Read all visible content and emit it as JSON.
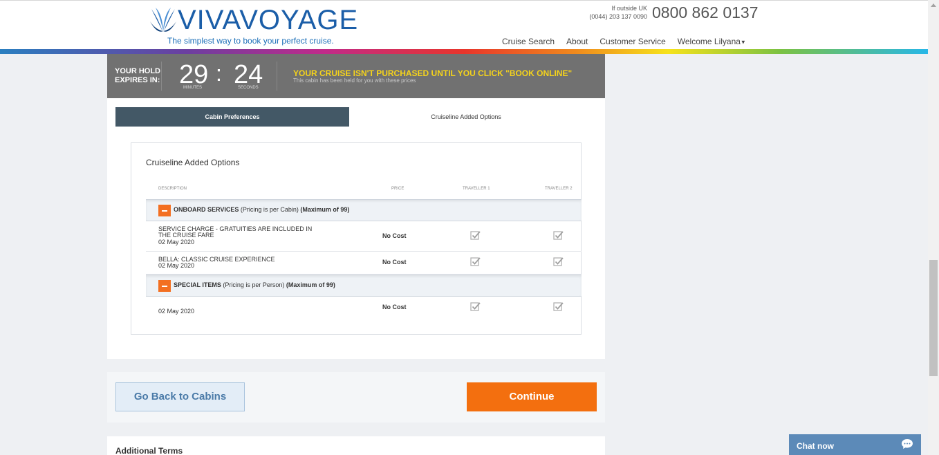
{
  "header": {
    "brand": "VIVAVOYAGE",
    "tagline": "The simplest way to book your perfect cruise.",
    "phone_note_line1": "If outside UK",
    "phone_note_line2": "(0044) 203 137 0090",
    "phone": "0800 862 0137",
    "nav": [
      "Cruise Search",
      "About",
      "Customer Service",
      "Welcome Lilyana"
    ]
  },
  "hold": {
    "label_line1": "YOUR HOLD",
    "label_line2": "EXPIRES IN:",
    "minutes": "29",
    "minutes_label": "MINUTES",
    "separator": ":",
    "seconds": "24",
    "seconds_label": "SECONDS",
    "message": "YOUR CRUISE ISN'T PURCHASED UNTIL YOU CLICK \"BOOK ONLINE\"",
    "sub": "This cabin has been held for you with these prices"
  },
  "tabs": [
    {
      "label": "Cabin Preferences",
      "active": true
    },
    {
      "label": "Cruiseline Added Options",
      "active": false
    }
  ],
  "options": {
    "title": "Cruiseline Added Options",
    "columns": [
      "DESCRIPTION",
      "PRICE",
      "TRAVELLER 1",
      "TRAVELLER 2"
    ],
    "sections": [
      {
        "name": "ONBOARD SERVICES",
        "note": "(Pricing is per Cabin)",
        "max": "(Maximum of 99)",
        "items": [
          {
            "description": "SERVICE CHARGE - GRATUITIES ARE INCLUDED IN THE CRUISE FARE",
            "date": "02 May 2020",
            "price": "No Cost"
          },
          {
            "description": "BELLA: CLASSIC CRUISE EXPERIENCE",
            "date": "02 May 2020",
            "price": "No Cost"
          }
        ]
      },
      {
        "name": "SPECIAL ITEMS",
        "note": "(Pricing is per Person)",
        "max": "(Maximum of 99)",
        "items": [
          {
            "description": "",
            "date": "02 May 2020",
            "price": "No Cost"
          }
        ]
      }
    ]
  },
  "actions": {
    "back_label": "Go Back to Cabins",
    "continue_label": "Continue"
  },
  "terms_label": "Additional Terms",
  "chat_label": "Chat now",
  "colors": {
    "accent": "#f36f0f",
    "tab_active": "#435866",
    "hold_bar": "#717171",
    "hold_message": "#f5d31b",
    "brand": "#1b5ea8"
  }
}
